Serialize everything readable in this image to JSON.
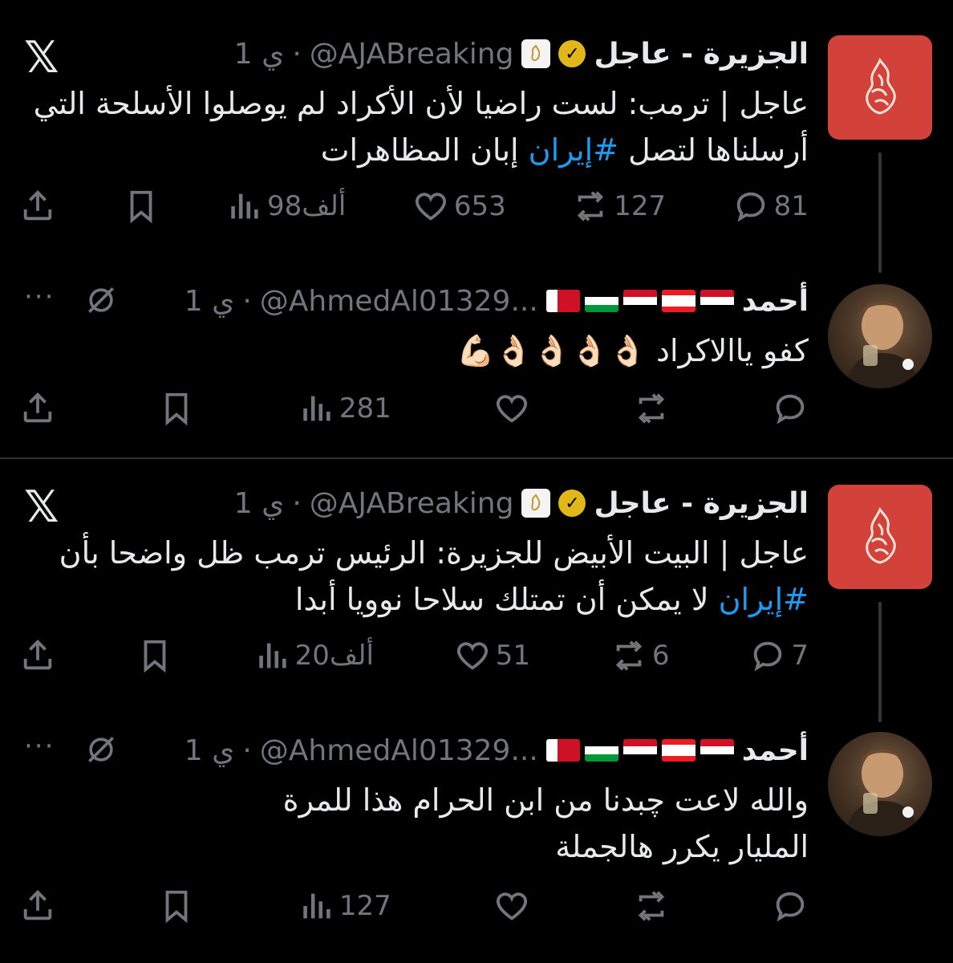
{
  "threads": [
    {
      "main": {
        "name": "الجزيرة - عاجل",
        "handle": "@AJABreaking",
        "dot": "·",
        "time": "1 ي",
        "text_prefix": "عاجل | ترمب: لست راضيا لأن الأكراد لم يوصلوا الأسلحة التي أرسلناها لتصل ",
        "hashtag": "#إيران",
        "text_suffix": " إبان المظاهرات",
        "replies": "81",
        "reposts": "127",
        "likes": "653",
        "views": "98ألف"
      },
      "reply": {
        "name": "أحمد",
        "handle": "@AhmedAl01329...",
        "dot": "·",
        "time": "1 ي",
        "text": "كفو ياالاكراد 👌🏻👌🏻👌🏻👌🏻💪🏻",
        "views": "281"
      }
    },
    {
      "main": {
        "name": "الجزيرة - عاجل",
        "handle": "@AJABreaking",
        "dot": "·",
        "time": "1 ي",
        "text_prefix": "عاجل | البيت الأبيض للجزيرة: الرئيس ترمب ظل واضحا بأن ",
        "hashtag": "#إيران",
        "text_suffix": " لا يمكن أن تمتلك سلاحا نوويا أبدا",
        "replies": "7",
        "reposts": "6",
        "likes": "51",
        "views": "20ألف"
      },
      "reply": {
        "name": "أحمد",
        "handle": "@AhmedAl01329...",
        "dot": "·",
        "time": "1 ي",
        "text": "والله لاعت چبدنا من ابن الحرام هذا للمرة المليار يكرر هالجملة",
        "views": "127"
      }
    }
  ],
  "icons": {
    "brand": "x-logo-icon",
    "more": "more-icon",
    "mute": "mute-icon",
    "reply": "reply-icon",
    "repost": "repost-icon",
    "like": "like-icon",
    "views": "views-icon",
    "bookmark": "bookmark-icon",
    "share": "share-icon"
  },
  "glyphs": {
    "x": "𝕏",
    "more": "···",
    "verified": "✓"
  },
  "colors": {
    "background": "#000000",
    "text": "#e7e9ea",
    "muted": "#71767b",
    "link": "#1d9bf0",
    "aj_red": "#d2423a",
    "verified_gold": "#e2b719",
    "divider": "#2f3336"
  }
}
